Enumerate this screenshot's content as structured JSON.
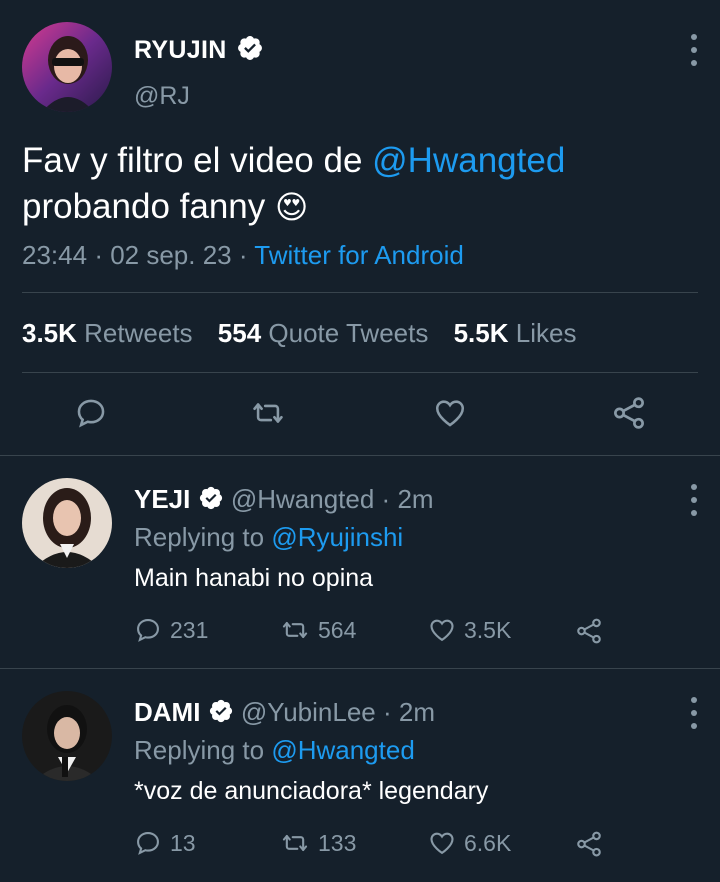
{
  "main_tweet": {
    "name": "RYUJIN",
    "handle": "@RJ",
    "text_before": "Fav y filtro el video de ",
    "mention": "@Hwangted",
    "text_line2": "probando fanny",
    "emoji": "😍",
    "time": "23:44",
    "date": "02 sep. 23",
    "source": "Twitter for Android",
    "stats": {
      "retweets_count": "3.5K",
      "retweets_label": "Retweets",
      "quotes_count": "554",
      "quotes_label": "Quote Tweets",
      "likes_count": "5.5K",
      "likes_label": "Likes"
    }
  },
  "replies": [
    {
      "name": "YEJI",
      "handle": "@Hwangted",
      "time": "2m",
      "replying_label": "Replying to",
      "replying_to": "@Ryujinshi",
      "text": "Main hanabi no opina",
      "comments": "231",
      "retweets": "564",
      "likes": "3.5K"
    },
    {
      "name": "DAMI",
      "handle": "@YubinLee",
      "time": "2m",
      "replying_label": "Replying to",
      "replying_to": "@Hwangted",
      "text": "*voz de anunciadora* legendary",
      "comments": "13",
      "retweets": "133",
      "likes": "6.6K"
    }
  ],
  "colors": {
    "background": "#15202b",
    "accent": "#1d9bf0",
    "muted": "#8899a6",
    "divider": "#38444d"
  }
}
